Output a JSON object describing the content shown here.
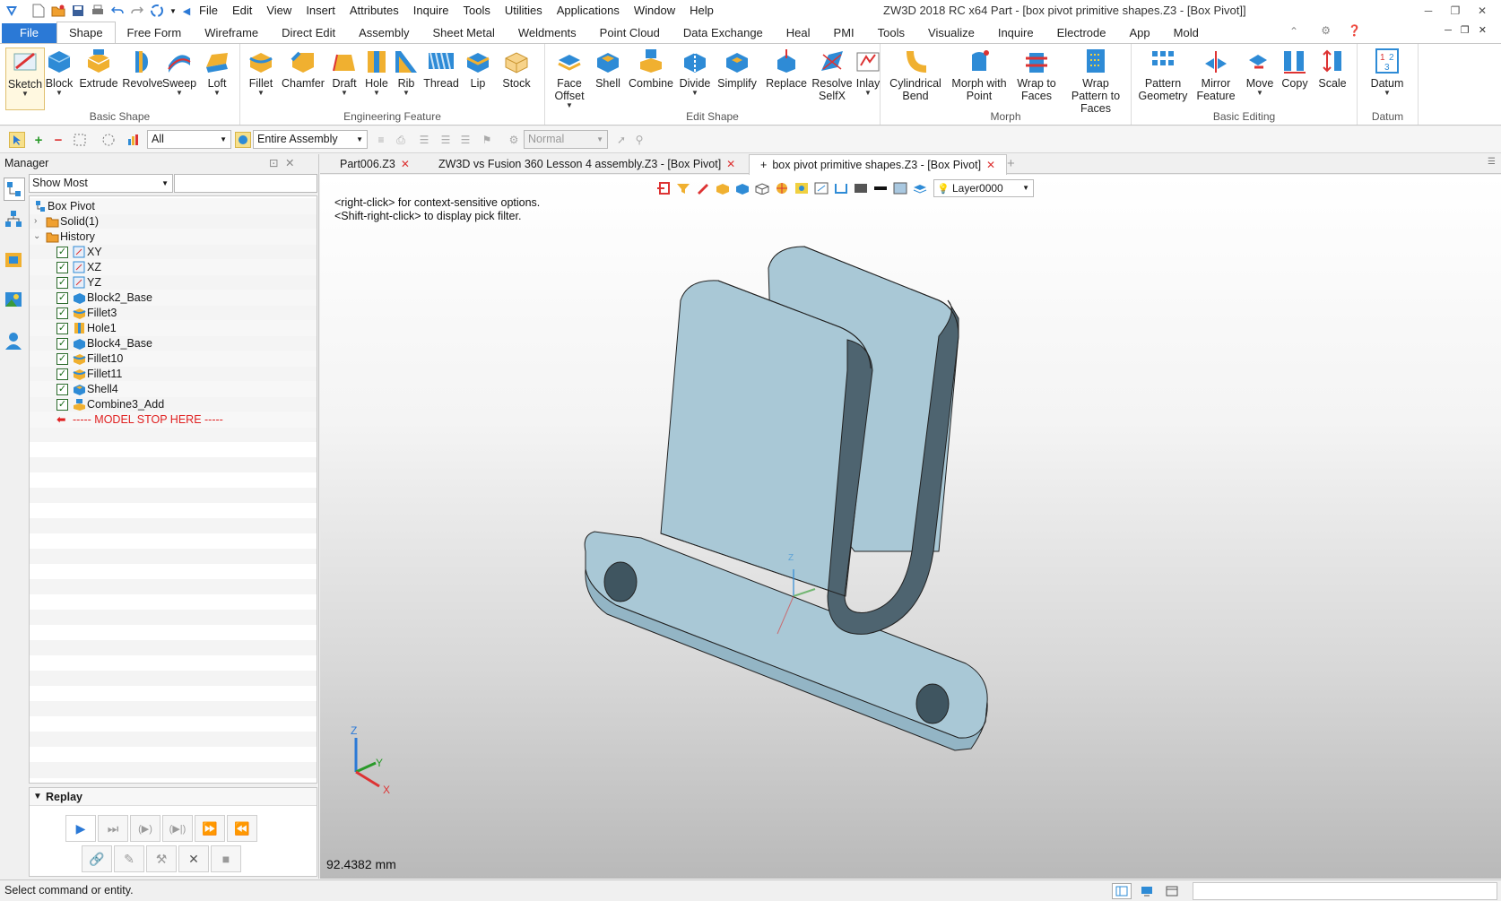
{
  "app": {
    "title": "ZW3D 2018 RC x64      Part - [box pivot primitive shapes.Z3 - [Box Pivot]]"
  },
  "menus": [
    "File",
    "Edit",
    "View",
    "Insert",
    "Attributes",
    "Inquire",
    "Tools",
    "Utilities",
    "Applications",
    "Window",
    "Help"
  ],
  "ribbon_tabs": [
    "File",
    "Shape",
    "Free Form",
    "Wireframe",
    "Direct Edit",
    "Assembly",
    "Sheet Metal",
    "Weldments",
    "Point Cloud",
    "Data Exchange",
    "Heal",
    "PMI",
    "Tools",
    "Visualize",
    "Inquire",
    "Electrode",
    "App",
    "Mold"
  ],
  "active_ribbon_tab": "Shape",
  "ribbon_groups": {
    "basic_shape": {
      "label": "Basic Shape",
      "buttons": [
        "Sketch",
        "Block",
        "Extrude",
        "Revolve",
        "Sweep",
        "Loft"
      ]
    },
    "engineering_feature": {
      "label": "Engineering Feature",
      "buttons": [
        "Fillet",
        "Chamfer",
        "Draft",
        "Hole",
        "Rib",
        "Thread",
        "Lip",
        "Stock"
      ]
    },
    "edit_shape": {
      "label": "Edit Shape",
      "buttons": [
        "Face Offset",
        "Shell",
        "Combine",
        "Divide",
        "Simplify",
        "Replace",
        "Resolve SelfX",
        "Inlay"
      ]
    },
    "morph": {
      "label": "Morph",
      "buttons": [
        "Cylindrical Bend",
        "Morph with Point",
        "Wrap to Faces",
        "Wrap Pattern to Faces"
      ]
    },
    "basic_editing": {
      "label": "Basic Editing",
      "buttons": [
        "Pattern Geometry",
        "Mirror Feature",
        "Move",
        "Copy",
        "Scale"
      ]
    },
    "datum": {
      "label": "Datum",
      "buttons": [
        "Datum"
      ]
    }
  },
  "toolbar": {
    "filter_value": "All",
    "scope_value": "Entire Assembly",
    "mode_value": "Normal"
  },
  "manager": {
    "title": "Manager",
    "filter_value": "Show Most",
    "tree": [
      {
        "label": "Box Pivot",
        "level": 0,
        "type": "root"
      },
      {
        "label": "Solid(1)",
        "level": 1,
        "type": "folder"
      },
      {
        "label": "History",
        "level": 1,
        "type": "folder"
      },
      {
        "label": "XY",
        "level": 2,
        "type": "plane"
      },
      {
        "label": "XZ",
        "level": 2,
        "type": "plane"
      },
      {
        "label": "YZ",
        "level": 2,
        "type": "plane"
      },
      {
        "label": "Block2_Base",
        "level": 2,
        "type": "block"
      },
      {
        "label": "Fillet3",
        "level": 2,
        "type": "fillet"
      },
      {
        "label": "Hole1",
        "level": 2,
        "type": "hole"
      },
      {
        "label": "Block4_Base",
        "level": 2,
        "type": "block"
      },
      {
        "label": "Fillet10",
        "level": 2,
        "type": "fillet"
      },
      {
        "label": "Fillet11",
        "level": 2,
        "type": "fillet"
      },
      {
        "label": "Shell4",
        "level": 2,
        "type": "shell"
      },
      {
        "label": "Combine3_Add",
        "level": 2,
        "type": "combine"
      }
    ],
    "stop_marker": "----- MODEL STOP HERE -----",
    "replay_label": "Replay"
  },
  "doc_tabs": [
    {
      "label": "Part006.Z3",
      "active": false
    },
    {
      "label": "ZW3D vs Fusion 360 Lesson 4 assembly.Z3 - [Box Pivot]",
      "active": false
    },
    {
      "label": "box pivot primitive shapes.Z3 - [Box Pivot]",
      "active": true
    }
  ],
  "viewport": {
    "hint_line1": "<right-click> for context-sensitive options.",
    "hint_line2": "<Shift-right-click> to display pick filter.",
    "layer": "Layer0000",
    "measurement": "92.4382 mm",
    "axis_labels": {
      "x": "X",
      "y": "Y",
      "z": "Z"
    }
  },
  "status": {
    "text": "Select command or entity."
  },
  "colors": {
    "accent": "#2b79d6",
    "part_fill": "#a9c8d6",
    "part_dark": "#4e6470",
    "stop_marker": "#e02020"
  }
}
